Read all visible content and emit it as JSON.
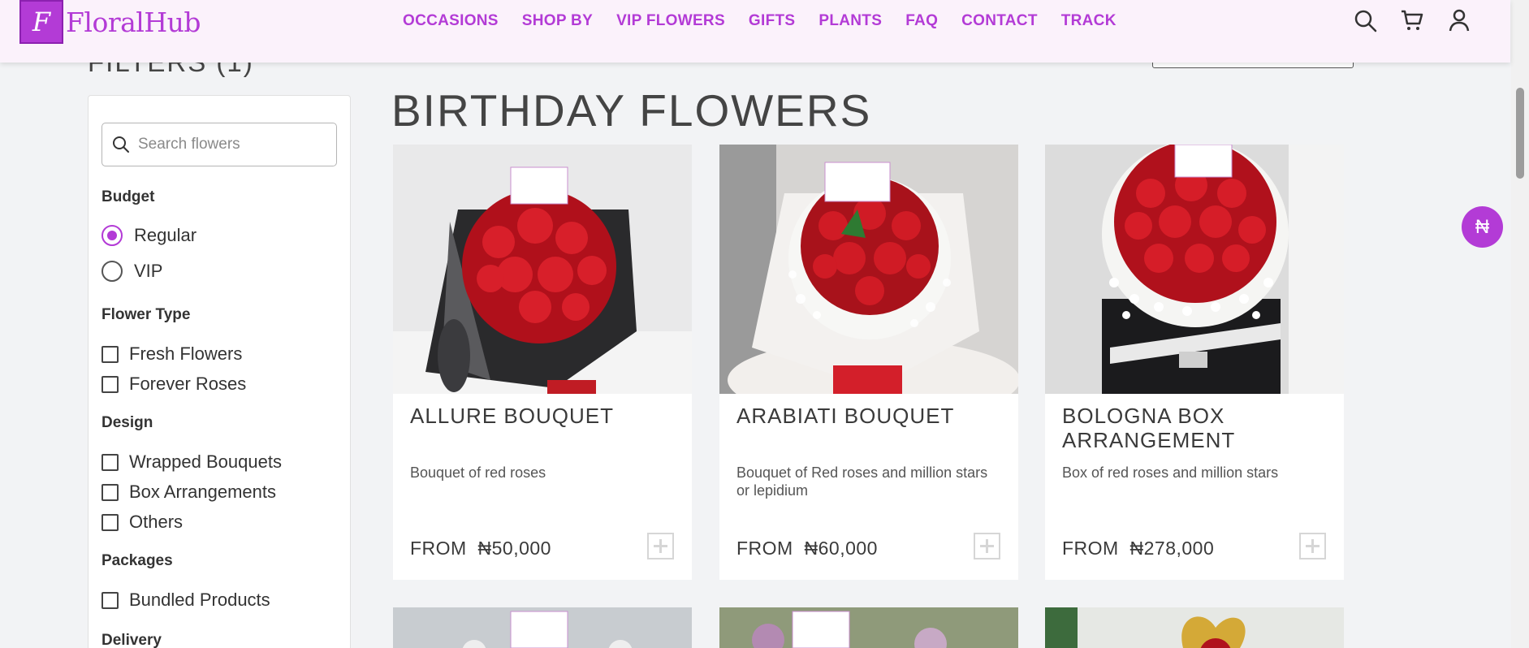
{
  "brand": {
    "logo_letter": "F",
    "name": "FloralHub"
  },
  "nav": [
    {
      "label": "OCCASIONS"
    },
    {
      "label": "SHOP BY"
    },
    {
      "label": "VIP FLOWERS"
    },
    {
      "label": "GIFTS"
    },
    {
      "label": "PLANTS"
    },
    {
      "label": "FAQ"
    },
    {
      "label": "CONTACT"
    },
    {
      "label": "TRACK"
    }
  ],
  "header_icons": [
    "search-icon",
    "cart-icon",
    "user-icon"
  ],
  "filters": {
    "title": "FILTERS (1)",
    "search_placeholder": "Search flowers",
    "budget": {
      "title": "Budget",
      "options": [
        {
          "label": "Regular",
          "selected": true
        },
        {
          "label": "VIP",
          "selected": false
        }
      ]
    },
    "flower_type": {
      "title": "Flower Type",
      "options": [
        {
          "label": "Fresh Flowers"
        },
        {
          "label": "Forever Roses"
        }
      ]
    },
    "design": {
      "title": "Design",
      "options": [
        {
          "label": "Wrapped Bouquets"
        },
        {
          "label": "Box Arrangements"
        },
        {
          "label": "Others"
        }
      ]
    },
    "packages": {
      "title": "Packages",
      "options": [
        {
          "label": "Bundled Products"
        }
      ]
    },
    "delivery": {
      "title": "Delivery"
    }
  },
  "page": {
    "title": "BIRTHDAY FLOWERS"
  },
  "products": [
    {
      "name": "ALLURE BOUQUET",
      "description": "Bouquet of red roses",
      "price_prefix": "FROM",
      "price": "₦50,000"
    },
    {
      "name": "ARABIATI BOUQUET",
      "description": "Bouquet of Red roses and million stars or lepidium",
      "price_prefix": "FROM",
      "price": "₦60,000"
    },
    {
      "name": "BOLOGNA BOX ARRANGEMENT",
      "description": "Box of red roses and million stars",
      "price_prefix": "FROM",
      "price": "₦278,000"
    }
  ],
  "currency_symbol": "₦",
  "colors": {
    "brand": "#b33bd6",
    "header_bg": "#fbf2fb",
    "page_bg": "#f2f3f5"
  }
}
